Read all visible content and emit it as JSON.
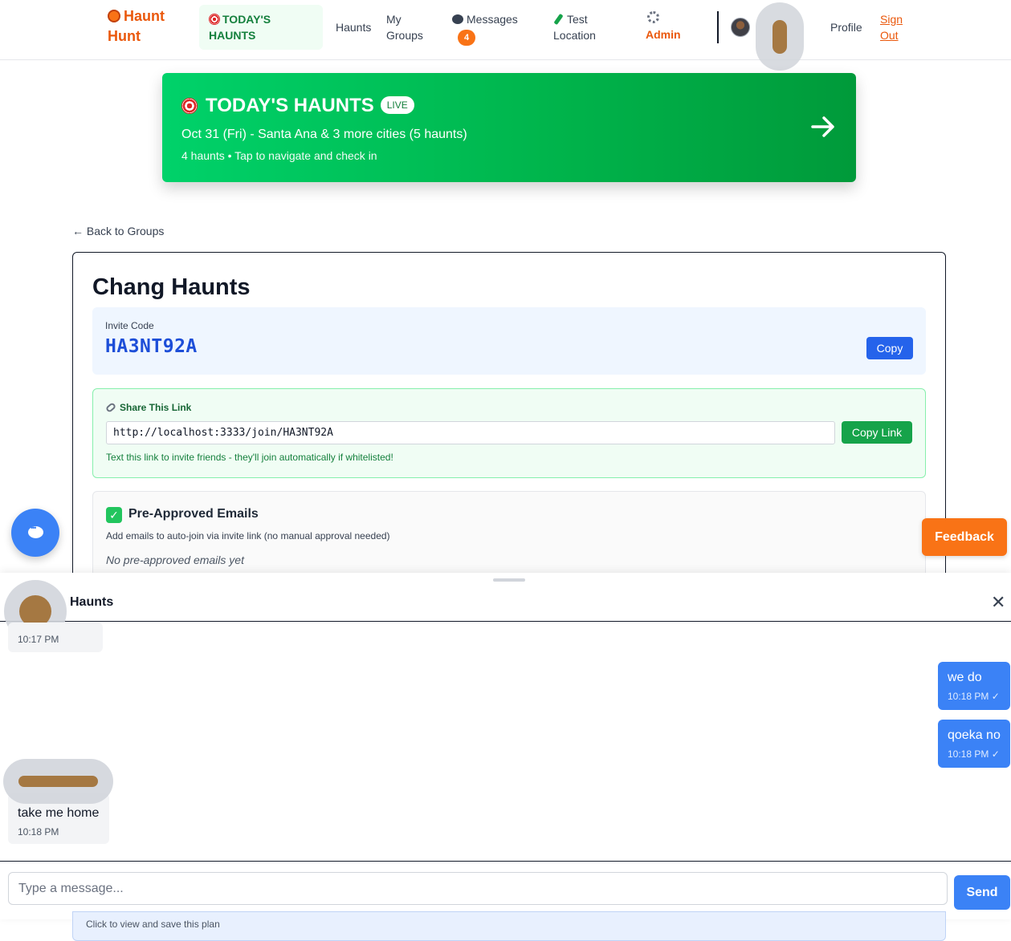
{
  "nav": {
    "logo_line1": "Haunt",
    "logo_line2": "Hunt",
    "today_line1": "TODAY'S",
    "today_line2": "HAUNTS",
    "haunts": "Haunts",
    "my_groups_line1": "My",
    "my_groups_line2": "Groups",
    "messages": "Messages",
    "messages_badge": "4",
    "test_location_line1": "Test",
    "test_location_line2": "Location",
    "admin": "Admin",
    "profile": "Profile",
    "sign_out_line1": "Sign",
    "sign_out_line2": "Out"
  },
  "hero": {
    "title": "TODAY'S HAUNTS",
    "live_badge": "LIVE",
    "subtitle": "Oct 31 (Fri) - Santa Ana & 3 more cities (5 haunts)",
    "meta": "4 haunts • Tap to navigate and check in"
  },
  "back_link": "← Back to Groups",
  "group": {
    "title": "Chang Haunts",
    "invite_label": "Invite Code",
    "invite_code": "HA3NT92A",
    "copy_label": "Copy",
    "share_title": "Share This Link",
    "share_url": "http://localhost:3333/join/HA3NT92A",
    "copy_link_label": "Copy Link",
    "share_help": "Text this link to invite friends - they'll join automatically if whitelisted!",
    "preapproved_title": "Pre-Approved Emails",
    "preapproved_desc": "Add emails to auto-join via invite link (no manual approval needed)",
    "preapproved_empty": "No pre-approved emails yet"
  },
  "feedback_label": "Feedback",
  "chat": {
    "title": "Haunts",
    "close": "✕",
    "messages": [
      {
        "direction": "in",
        "text": "",
        "time": "10:17 PM"
      },
      {
        "direction": "out",
        "text": "we do",
        "time": "10:18 PM ✓"
      },
      {
        "direction": "out",
        "text": "qoeka no",
        "time": "10:18 PM ✓"
      },
      {
        "direction": "in",
        "text": "take me home",
        "time": "10:18 PM"
      }
    ],
    "input_placeholder": "Type a message...",
    "send_label": "Send"
  },
  "plan_hint": "Click to view and save this plan",
  "colors": {
    "brand_orange": "#ea580c",
    "hero_green": "#00c85a",
    "primary_blue": "#3b82f6",
    "success_green": "#16a34a"
  }
}
